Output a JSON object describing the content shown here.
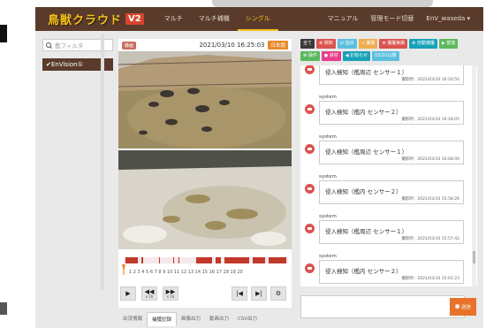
{
  "header": {
    "logo_text": "鳥獣クラウド",
    "version_badge": "V2",
    "nav": [
      "マルチ",
      "マルチ補機",
      "シングル"
    ],
    "active_nav": "シングル",
    "right_nav": [
      "マニュアル",
      "管理モード切替",
      "EnV_waseda ▾"
    ]
  },
  "sidebar": {
    "search_placeholder": "檻フィルタ",
    "selected_device": "✔EnVision①"
  },
  "camera": {
    "live_badge": "静画",
    "timestamp": "2021/03/10 16:25:03",
    "lang_badge": "日本語",
    "timeline_labels": "1 2 3 4 5 6 7 8 9 10 11 12 13 14 15 16 17 18 19 20",
    "controls": {
      "play": "▶",
      "rewind": "◀◀",
      "rewind_speed": "x 16",
      "forward": "▶▶",
      "forward_speed": "x 16",
      "prev": "|◀",
      "next": "▶|",
      "settings": "⚙"
    }
  },
  "tabs": [
    "出没情報",
    "捕獲記録",
    "画像出力",
    "動画出力",
    "CSV出力"
  ],
  "active_tab": "捕獲記録",
  "chat": {
    "buttons": [
      {
        "label": "全て",
        "color": "#3a3a3a"
      },
      {
        "label": "⊗ 検知",
        "color": "#d9534f"
      },
      {
        "label": "⇄ 指示",
        "color": "#5bc0de"
      },
      {
        "label": "→ 捕獲",
        "color": "#f0ad4e"
      },
      {
        "label": "⊗ 捕獲実績",
        "color": "#d9534f"
      },
      {
        "label": "⊗ 自動捕獲",
        "color": "#17a2b8"
      },
      {
        "label": "▶ 部落",
        "color": "#5cb85c"
      },
      {
        "label": "⊗ 操作",
        "color": "#5cb85c"
      },
      {
        "label": "● 資材",
        "color": "#e83e8c"
      },
      {
        "label": "◀ お知らせ",
        "color": "#17a2b8"
      },
      {
        "label": "03/10以降",
        "color": "#5bc0de"
      }
    ],
    "messages": [
      {
        "sender": "",
        "text": "侵入検知（檻周辺 センサー１）",
        "meta": "撮影時：2021/03/10 16:20:50"
      },
      {
        "sender": "system",
        "text": "侵入検知（檻内 センサー２）",
        "meta": "撮影時：2021/03/10 16:18:05"
      },
      {
        "sender": "system",
        "text": "侵入検知（檻周辺 センサー１）",
        "meta": "撮影時：2021/03/10 16:08:00"
      },
      {
        "sender": "system",
        "text": "侵入検知（檻内 センサー２）",
        "meta": "撮影時：2021/03/10 15:58:26"
      },
      {
        "sender": "system",
        "text": "侵入検知（檻周辺 センサー１）",
        "meta": "撮影時：2021/03/10 15:57:42"
      },
      {
        "sender": "system",
        "text": "侵入検知（檻内 センサー２）",
        "meta": "撮影時：2021/03/10 15:01:23"
      }
    ],
    "send_label": "送信"
  }
}
